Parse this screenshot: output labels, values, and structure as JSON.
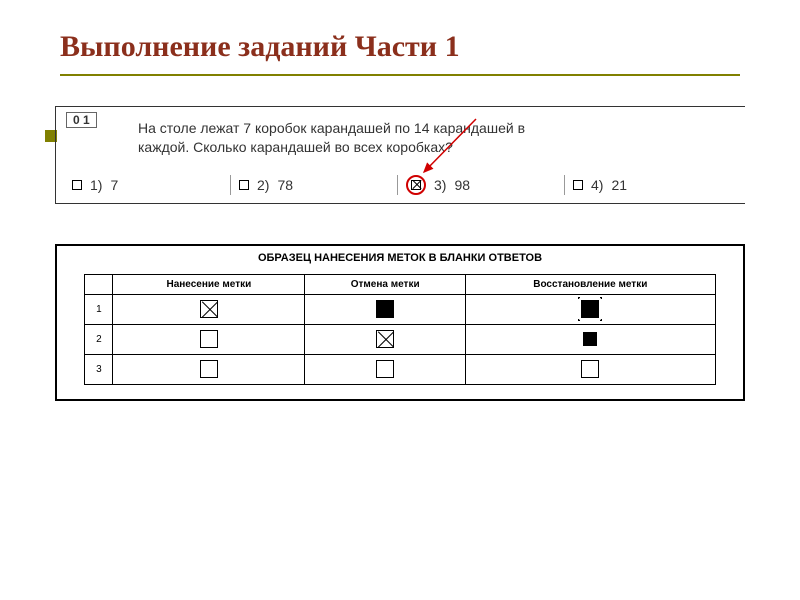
{
  "title": "Выполнение заданий Части 1",
  "task": {
    "number": "0 1",
    "question_line1": "На столе лежат 7 коробок карандашей по 14 карандашей в",
    "question_line2": "каждой. Сколько карандашей во всех коробках?",
    "options": [
      {
        "n": "1)",
        "v": "7"
      },
      {
        "n": "2)",
        "v": "78"
      },
      {
        "n": "3)",
        "v": "98"
      },
      {
        "n": "4)",
        "v": "21"
      }
    ],
    "selected_index": 2
  },
  "sample": {
    "heading": "ОБРАЗЕЦ НАНЕСЕНИЯ МЕТОК В БЛАНКИ ОТВЕТОВ",
    "columns": [
      "Нанесение метки",
      "Отмена метки",
      "Восстановление метки"
    ],
    "rows": [
      "1",
      "2",
      "3"
    ]
  }
}
